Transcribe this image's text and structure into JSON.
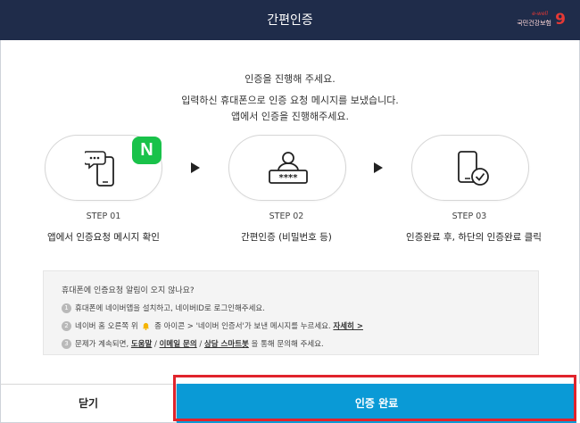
{
  "header": {
    "title": "간편인증",
    "brand_small": "e-well",
    "brand_name": "국민건강보험",
    "brand_mark": "9"
  },
  "intro": {
    "line1": "인증을 진행해 주세요.",
    "line2": "입력하신 휴대폰으로 인증 요청 메시지를 보냈습니다.",
    "line3": "앱에서 인증을 진행해주세요."
  },
  "steps": [
    {
      "num": "STEP 01",
      "desc": "앱에서 인증요청 메시지 확인",
      "icon": "phone-message-icon",
      "badge": "N"
    },
    {
      "num": "STEP 02",
      "desc": "간편인증 (비밀번호 등)",
      "icon": "user-password-icon"
    },
    {
      "num": "STEP 03",
      "desc": "인증완료 후, 하단의 인증완료 클릭",
      "icon": "phone-check-icon"
    }
  ],
  "notice": {
    "title": "휴대폰에 인증요청 알림이 오지 않나요?",
    "items": [
      {
        "num": "1",
        "text": "휴대폰에 네이버앱을 설치하고, 네이버ID로 로그인해주세요."
      },
      {
        "num": "2",
        "text_a": "네이버 홈 오른쪽 위",
        "text_b": "종 아이콘 > '네이버 인증서'가 보낸 메시지를 누르세요.",
        "link": "자세히 >"
      },
      {
        "num": "3",
        "text_a": "문제가 계속되면,",
        "link1": "도움말",
        "sep1": "/",
        "link2": "이메일 문의",
        "sep2": "/",
        "link3": "상담 스마트봇",
        "text_b": "을 통해 문의해 주세요."
      }
    ]
  },
  "footer": {
    "close_label": "닫기",
    "confirm_label": "인증 완료"
  },
  "colors": {
    "header_bg": "#1f2c4a",
    "confirm_bg": "#0a9ad6",
    "naver_green": "#19c24a",
    "highlight": "#e0242c"
  }
}
